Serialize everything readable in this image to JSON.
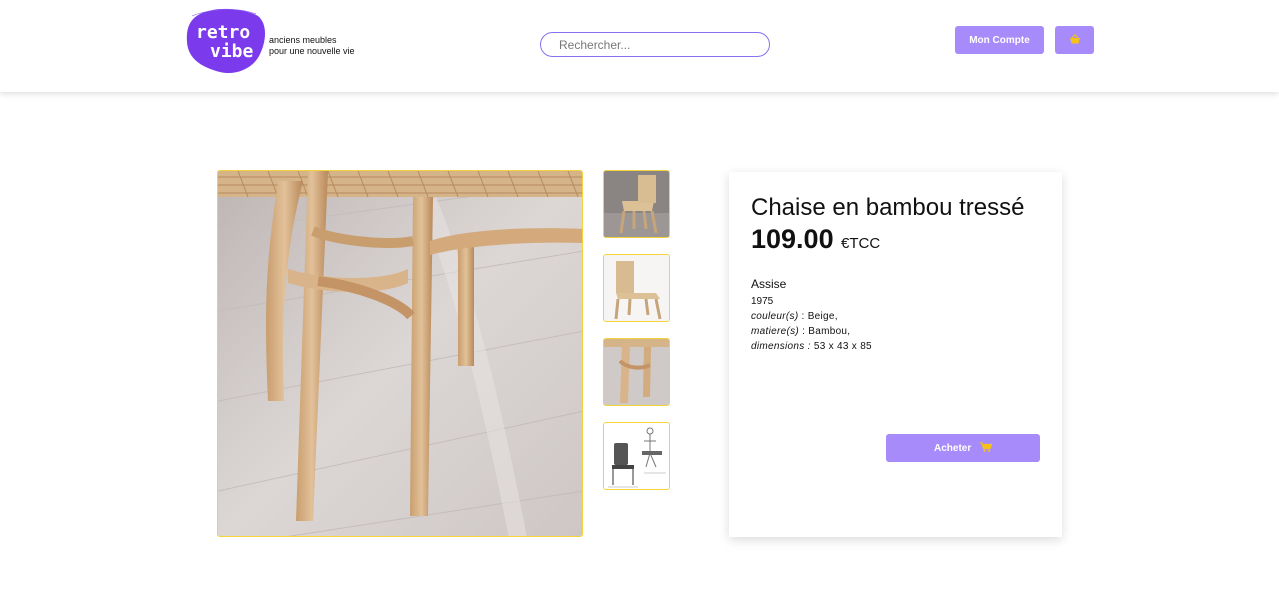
{
  "header": {
    "logo_text_top": "retro",
    "logo_text_bottom": "vibe",
    "tagline_line1": "anciens meubles",
    "tagline_line2": "pour une nouvelle vie",
    "search_placeholder": "Rechercher...",
    "account_label": "Mon Compte",
    "cart_icon": "basket-icon"
  },
  "product": {
    "title": "Chaise en bambou tressé",
    "price": "109.00",
    "currency": "€TCC",
    "category": "Assise",
    "year": "1975",
    "color_label": "couleur(s)",
    "color_value": " : Beige,",
    "material_label": "matiere(s)",
    "material_value": " : Bambou,",
    "dimensions_label": "dimensions :",
    "dimensions_value": " 53 x 43 x 85",
    "buy_label": "Acheter",
    "buy_icon": "cart-icon"
  },
  "colors": {
    "accent": "#a78bfa",
    "logo": "#7c3aed",
    "border_gold": "#f2d33c"
  }
}
